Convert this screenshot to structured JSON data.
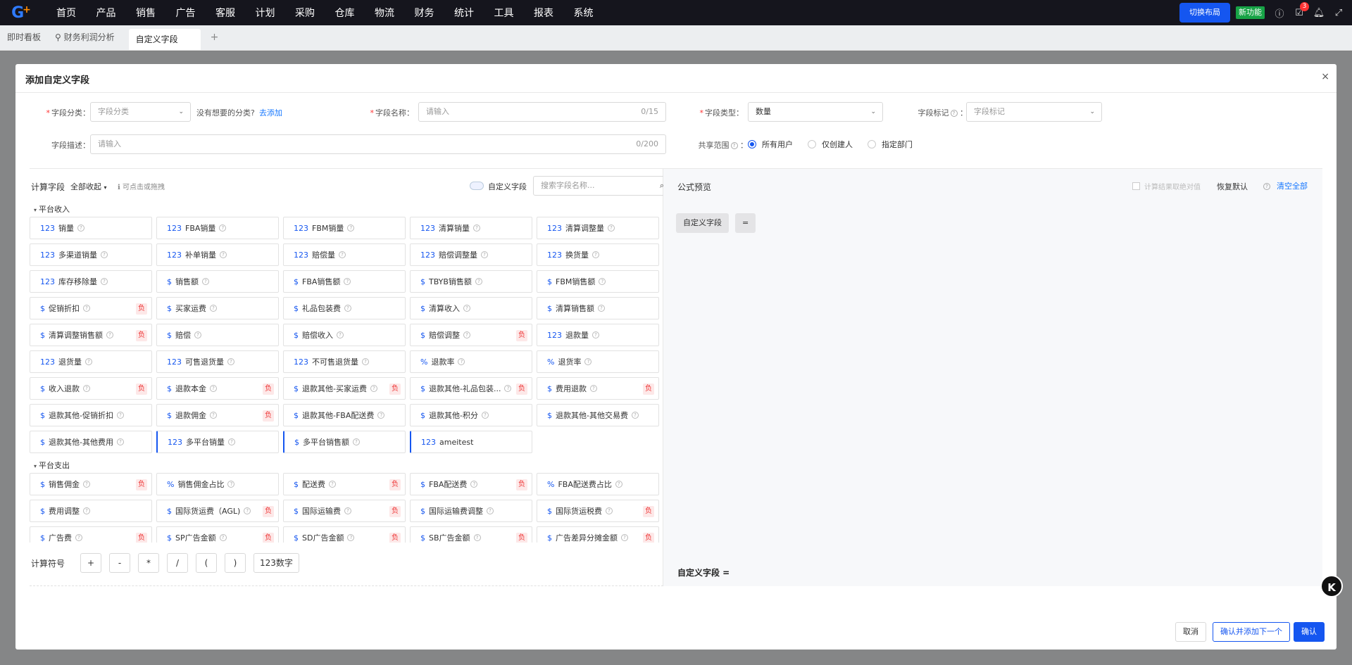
{
  "nav": {
    "logo_letter": "G",
    "logo_plus": "+",
    "menu": [
      "首页",
      "产品",
      "销售",
      "广告",
      "客服",
      "计划",
      "采购",
      "仓库",
      "物流",
      "财务",
      "统计",
      "工具",
      "报表",
      "系统"
    ],
    "switch_layout": "切换布局",
    "new_feature": "新功能",
    "notif_badge": "3"
  },
  "tabs": {
    "t1": "即时看板",
    "t2": "财务利润分析",
    "t3": "自定义字段",
    "add": "+"
  },
  "modal": {
    "title": "添加自定义字段",
    "close": "×",
    "form": {
      "category_label": "字段分类：",
      "category_placeholder": "字段分类",
      "no_category": "没有想要的分类?",
      "go_add": "去添加",
      "name_label": "字段名称：",
      "name_placeholder": "请输入",
      "name_count": "0/15",
      "type_label": "字段类型：",
      "type_value": "数量",
      "mark_label": "字段标记",
      "mark_placeholder": "字段标记",
      "desc_label": "字段描述：",
      "desc_placeholder": "请输入",
      "desc_count": "0/200",
      "scope_label": "共享范围",
      "scope_options": [
        "所有用户",
        "仅创建人",
        "指定部门"
      ]
    },
    "left": {
      "title": "计算字段",
      "collapse_all": "全部收起",
      "hint": "可点击或拖拽",
      "custom_toggle": "自定义字段",
      "search_placeholder": "搜索字段名称...",
      "section1": "平台收入",
      "fields1": [
        {
          "t": "123",
          "n": "销量",
          "h": true
        },
        {
          "t": "123",
          "n": "FBA销量",
          "h": true
        },
        {
          "t": "123",
          "n": "FBM销量",
          "h": true
        },
        {
          "t": "123",
          "n": "清算销量",
          "h": true
        },
        {
          "t": "123",
          "n": "清算调整量",
          "h": true
        },
        {
          "t": "123",
          "n": "多渠道销量",
          "h": true
        },
        {
          "t": "123",
          "n": "补单销量",
          "h": true
        },
        {
          "t": "123",
          "n": "赔偿量",
          "h": true
        },
        {
          "t": "123",
          "n": "赔偿调整量",
          "h": true
        },
        {
          "t": "123",
          "n": "换货量",
          "h": true
        },
        {
          "t": "123",
          "n": "库存移除量",
          "h": true
        },
        {
          "t": "$",
          "n": "销售额",
          "h": true
        },
        {
          "t": "$",
          "n": "FBA销售额",
          "h": true
        },
        {
          "t": "$",
          "n": "TBYB销售额",
          "h": true
        },
        {
          "t": "$",
          "n": "FBM销售额",
          "h": true
        },
        {
          "t": "$",
          "n": "促销折扣",
          "h": true,
          "neg": "负"
        },
        {
          "t": "$",
          "n": "买家运费",
          "h": true
        },
        {
          "t": "$",
          "n": "礼品包装费",
          "h": true
        },
        {
          "t": "$",
          "n": "清算收入",
          "h": true
        },
        {
          "t": "$",
          "n": "清算销售额",
          "h": true
        },
        {
          "t": "$",
          "n": "清算调整销售额",
          "h": true,
          "neg": "负"
        },
        {
          "t": "$",
          "n": "赔偿",
          "h": true
        },
        {
          "t": "$",
          "n": "赔偿收入",
          "h": true
        },
        {
          "t": "$",
          "n": "赔偿调整",
          "h": true,
          "neg": "负"
        },
        {
          "t": "123",
          "n": "退款量",
          "h": true
        },
        {
          "t": "123",
          "n": "退货量",
          "h": true
        },
        {
          "t": "123",
          "n": "可售退货量",
          "h": true
        },
        {
          "t": "123",
          "n": "不可售退货量",
          "h": true
        },
        {
          "t": "%",
          "n": "退款率",
          "h": true
        },
        {
          "t": "%",
          "n": "退货率",
          "h": true
        },
        {
          "t": "$",
          "n": "收入退款",
          "h": true,
          "neg": "负"
        },
        {
          "t": "$",
          "n": "退款本金",
          "h": true,
          "neg": "负"
        },
        {
          "t": "$",
          "n": "退款其他-买家运费",
          "h": true,
          "neg": "负"
        },
        {
          "t": "$",
          "n": "退款其他-礼品包装...",
          "h": true,
          "neg": "负"
        },
        {
          "t": "$",
          "n": "费用退款",
          "h": true,
          "neg": "负"
        },
        {
          "t": "$",
          "n": "退款其他-促销折扣",
          "h": true
        },
        {
          "t": "$",
          "n": "退款佣金",
          "h": true,
          "neg": "负"
        },
        {
          "t": "$",
          "n": "退款其他-FBA配送费",
          "h": true
        },
        {
          "t": "$",
          "n": "退款其他-积分",
          "h": true
        },
        {
          "t": "$",
          "n": "退款其他-其他交易费",
          "h": true
        },
        {
          "t": "$",
          "n": "退款其他-其他费用",
          "h": true
        },
        {
          "t": "123",
          "n": "多平台销量",
          "h": true,
          "custom": true
        },
        {
          "t": "$",
          "n": "多平台销售额",
          "h": true,
          "custom": true
        },
        {
          "t": "123",
          "n": "ameitest",
          "h": false,
          "custom": true
        }
      ],
      "section2": "平台支出",
      "fields2": [
        {
          "t": "$",
          "n": "销售佣金",
          "h": true,
          "neg": "负"
        },
        {
          "t": "%",
          "n": "销售佣金占比",
          "h": true
        },
        {
          "t": "$",
          "n": "配送费",
          "h": true,
          "neg": "负"
        },
        {
          "t": "$",
          "n": "FBA配送费",
          "h": true,
          "neg": "负"
        },
        {
          "t": "%",
          "n": "FBA配送费占比",
          "h": true
        },
        {
          "t": "$",
          "n": "费用调整",
          "h": true
        },
        {
          "t": "$",
          "n": "国际货运费（AGL)",
          "h": true,
          "neg": "负"
        },
        {
          "t": "$",
          "n": "国际运输费",
          "h": true,
          "neg": "负"
        },
        {
          "t": "$",
          "n": "国际运输费调整",
          "h": true
        },
        {
          "t": "$",
          "n": "国际货运税费",
          "h": true,
          "neg": "负"
        },
        {
          "t": "$",
          "n": "广告费",
          "h": true,
          "neg": "负"
        },
        {
          "t": "$",
          "n": "SP广告金额",
          "h": true,
          "neg": "负"
        },
        {
          "t": "$",
          "n": "SD广告金额",
          "h": true,
          "neg": "负"
        },
        {
          "t": "$",
          "n": "SB广告金额",
          "h": true,
          "neg": "负"
        },
        {
          "t": "$",
          "n": "广告差异分摊金额",
          "h": true,
          "neg": "负"
        }
      ],
      "ops_label": "计算符号",
      "ops": [
        "+",
        "-",
        "*",
        "/",
        "(",
        ")",
        "123数字"
      ]
    },
    "right": {
      "title": "公式预览",
      "abs_check": "计算结果取绝对值",
      "restore": "恢复默认",
      "clear": "清空全部",
      "chip1": "自定义字段",
      "chip2": "=",
      "result": "自定义字段 ="
    },
    "footer": {
      "cancel": "取消",
      "confirm_next": "确认并添加下一个",
      "confirm": "确认"
    }
  },
  "colors": {
    "primary": "#1556f0",
    "nav_bg": "#15151d",
    "neg_bg": "#fde8e8",
    "neg_fg": "#e33"
  }
}
